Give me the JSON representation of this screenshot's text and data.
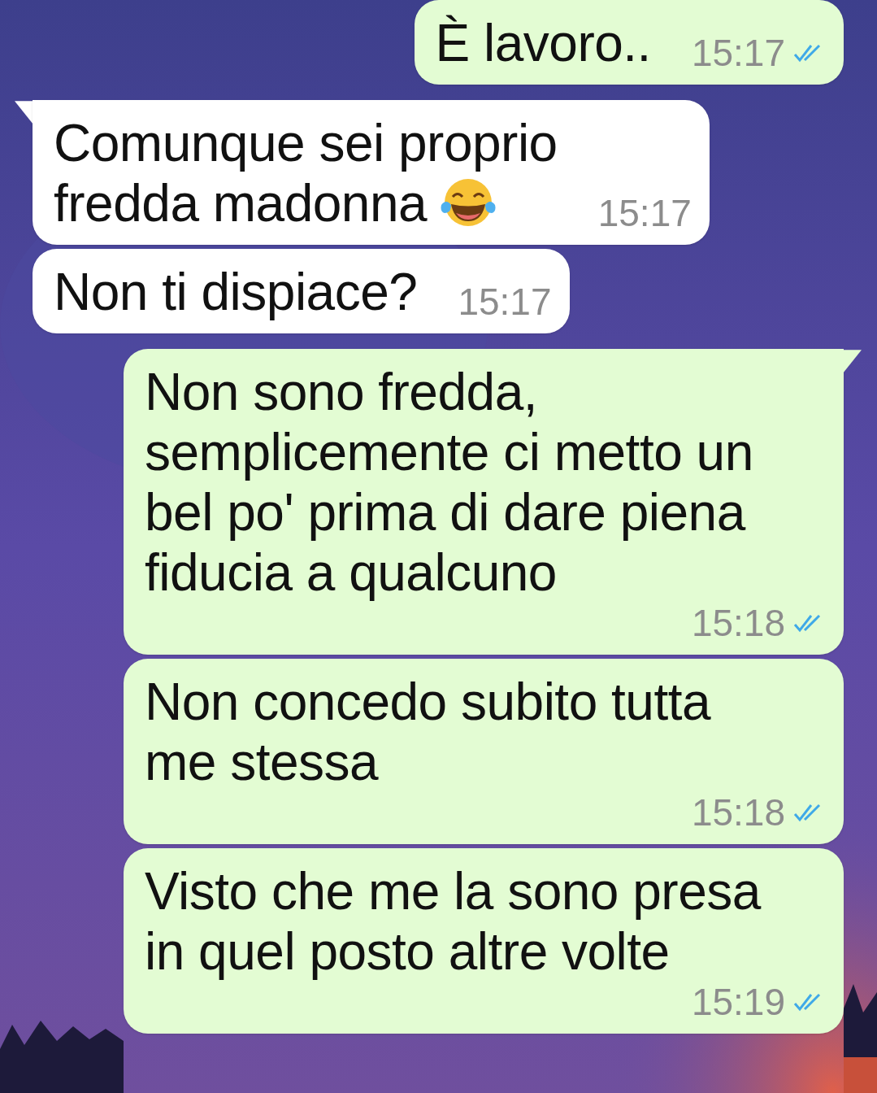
{
  "messages": [
    {
      "kind": "outgoing",
      "tail": false,
      "text": "È lavoro..",
      "time": "15:17",
      "read": true
    },
    {
      "kind": "incoming",
      "tail": true,
      "text": "Comunque sei proprio\nfredda madonna",
      "laughing_emoji": true,
      "time": "15:17"
    },
    {
      "kind": "incoming",
      "tail": false,
      "text": "Non ti dispiace?",
      "time": "15:17"
    },
    {
      "kind": "outgoing",
      "tail": true,
      "text": "Non sono fredda,\nsemplicemente ci metto un\nbel po' prima di dare piena\nfiducia a qualcuno",
      "time": "15:18",
      "read": true
    },
    {
      "kind": "outgoing",
      "tail": false,
      "text": "Non concedo subito tutta\nme stessa",
      "time": "15:18",
      "read": true
    },
    {
      "kind": "outgoing",
      "tail": false,
      "text": "Visto che me la sono presa\nin quel posto altre volte",
      "time": "15:19",
      "read": true
    }
  ]
}
